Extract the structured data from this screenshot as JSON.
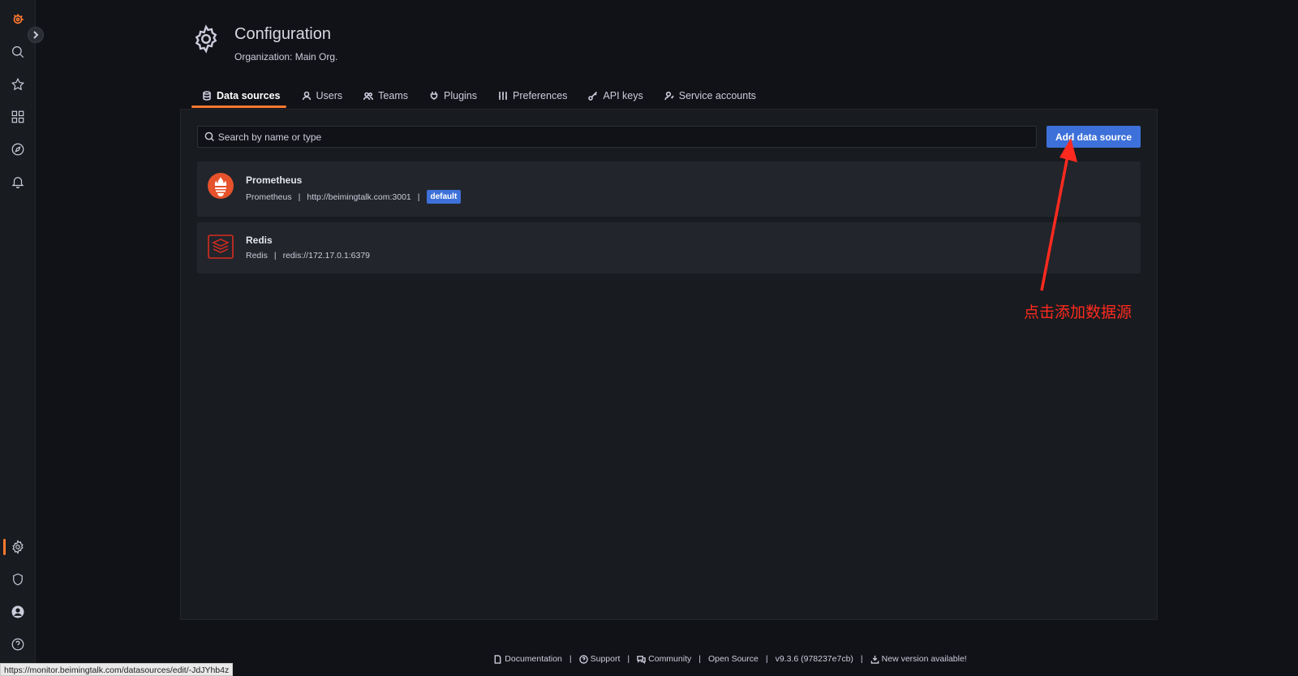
{
  "header": {
    "title": "Configuration",
    "subtitle": "Organization: Main Org."
  },
  "tabs": [
    {
      "label": "Data sources",
      "icon": "database-icon",
      "active": true
    },
    {
      "label": "Users",
      "icon": "user-icon",
      "active": false
    },
    {
      "label": "Teams",
      "icon": "users-icon",
      "active": false
    },
    {
      "label": "Plugins",
      "icon": "plug-icon",
      "active": false
    },
    {
      "label": "Preferences",
      "icon": "sliders-icon",
      "active": false
    },
    {
      "label": "API keys",
      "icon": "key-icon",
      "active": false
    },
    {
      "label": "Service accounts",
      "icon": "service-account-icon",
      "active": false
    }
  ],
  "search": {
    "placeholder": "Search by name or type",
    "value": ""
  },
  "add_button": {
    "label": "Add data source"
  },
  "datasources": [
    {
      "name": "Prometheus",
      "type": "Prometheus",
      "url": "http://beimingtalk.com:3001",
      "badge": "default"
    },
    {
      "name": "Redis",
      "type": "Redis",
      "url": "redis://172.17.0.1:6379"
    }
  ],
  "annotation": {
    "text": "点击添加数据源",
    "color": "#ff2a1f"
  },
  "footer": {
    "documentation": "Documentation",
    "support": "Support",
    "community": "Community",
    "open_source": "Open Source",
    "version": "v9.3.6 (978237e7cb)",
    "new_version": "New version available!"
  },
  "status_url": "https://monitor.beimingtalk.com/datasources/edit/-JdJYhb4z",
  "colors": {
    "accent": "#ff7830",
    "primary": "#3d71d9",
    "background": "#111217",
    "panel": "#181b1f"
  }
}
